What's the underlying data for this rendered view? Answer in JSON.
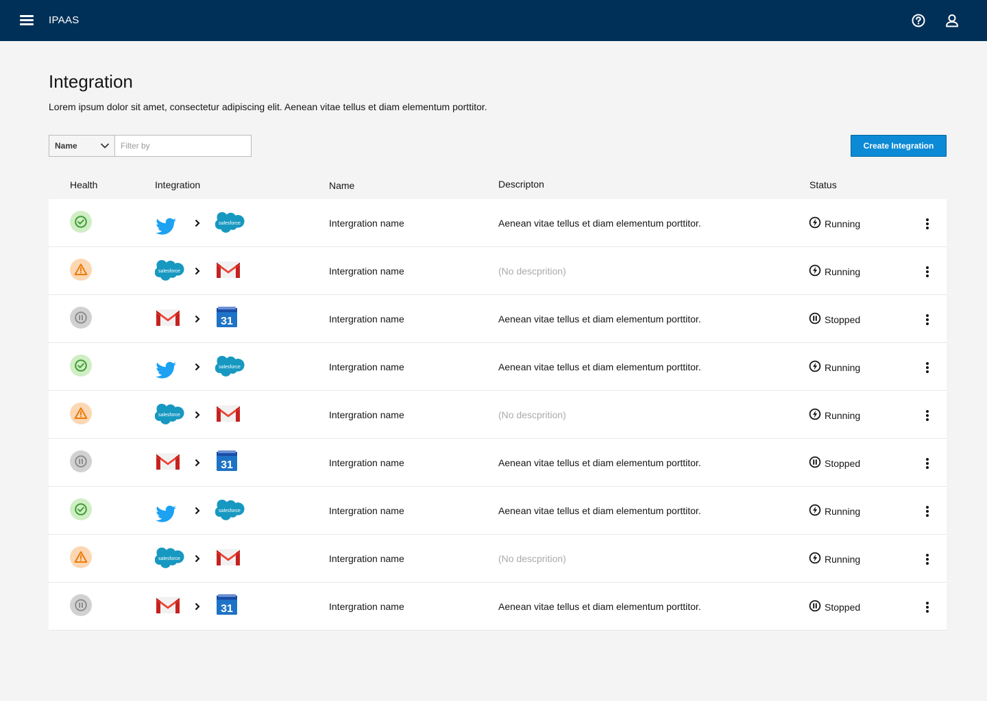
{
  "app": {
    "brand": "IPAAS"
  },
  "page": {
    "title": "Integration",
    "description": "Lorem ipsum dolor sit amet, consectetur adipiscing elit. Aenean vitae tellus et diam elementum porttitor."
  },
  "filter": {
    "field": "Name",
    "placeholder": "Filter by",
    "value": ""
  },
  "actions": {
    "create_label": "Create Integration"
  },
  "columns": {
    "health": "Health",
    "integration": "Integration",
    "name": "Name",
    "description": "Descripton",
    "status": "Status"
  },
  "colors": {
    "header": "#003058",
    "primary": "#0c8ad6",
    "ok": "#3f9c35",
    "warn": "#ec7a08",
    "paused": "#8b8d8f"
  },
  "rows": [
    {
      "health": "ok",
      "from": "twitter-icon",
      "to": "salesforce-icon",
      "name": "Intergration name",
      "description": "Aenean vitae tellus et diam elementum porttitor.",
      "status": "Running"
    },
    {
      "health": "warn",
      "from": "salesforce-icon",
      "to": "gmail-icon",
      "name": "Intergration name",
      "description": "(No descprition)",
      "status": "Running"
    },
    {
      "health": "paused",
      "from": "gmail-icon",
      "to": "calendar-icon",
      "name": "Intergration name",
      "description": "Aenean vitae tellus et diam elementum porttitor.",
      "status": "Stopped"
    },
    {
      "health": "ok",
      "from": "twitter-icon",
      "to": "salesforce-icon",
      "name": "Intergration name",
      "description": "Aenean vitae tellus et diam elementum porttitor.",
      "status": "Running"
    },
    {
      "health": "warn",
      "from": "salesforce-icon",
      "to": "gmail-icon",
      "name": "Intergration name",
      "description": "(No descprition)",
      "status": "Running"
    },
    {
      "health": "paused",
      "from": "gmail-icon",
      "to": "calendar-icon",
      "name": "Intergration name",
      "description": "Aenean vitae tellus et diam elementum porttitor.",
      "status": "Stopped"
    },
    {
      "health": "ok",
      "from": "twitter-icon",
      "to": "salesforce-icon",
      "name": "Intergration name",
      "description": "Aenean vitae tellus et diam elementum porttitor.",
      "status": "Running"
    },
    {
      "health": "warn",
      "from": "salesforce-icon",
      "to": "gmail-icon",
      "name": "Intergration name",
      "description": "(No descprition)",
      "status": "Running"
    },
    {
      "health": "paused",
      "from": "gmail-icon",
      "to": "calendar-icon",
      "name": "Intergration name",
      "description": "Aenean vitae tellus et diam elementum porttitor.",
      "status": "Stopped"
    }
  ],
  "icon_text": {
    "salesforce": "salesforce",
    "calendar": "31"
  }
}
